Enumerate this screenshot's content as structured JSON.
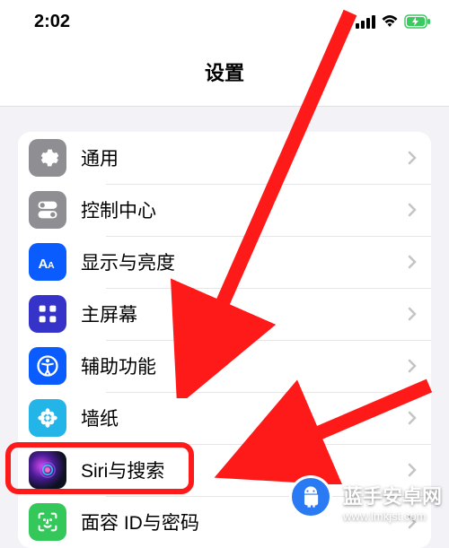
{
  "status": {
    "time": "2:02"
  },
  "header": {
    "title": "设置"
  },
  "rows": [
    {
      "label": "通用"
    },
    {
      "label": "控制中心"
    },
    {
      "label": "显示与亮度"
    },
    {
      "label": "主屏幕"
    },
    {
      "label": "辅助功能"
    },
    {
      "label": "墙纸"
    },
    {
      "label": "Siri与搜索"
    },
    {
      "label": "面容 ID与密码"
    }
  ],
  "watermark": {
    "brand": "蓝手安卓网",
    "url": "www.lmkjst.com"
  }
}
